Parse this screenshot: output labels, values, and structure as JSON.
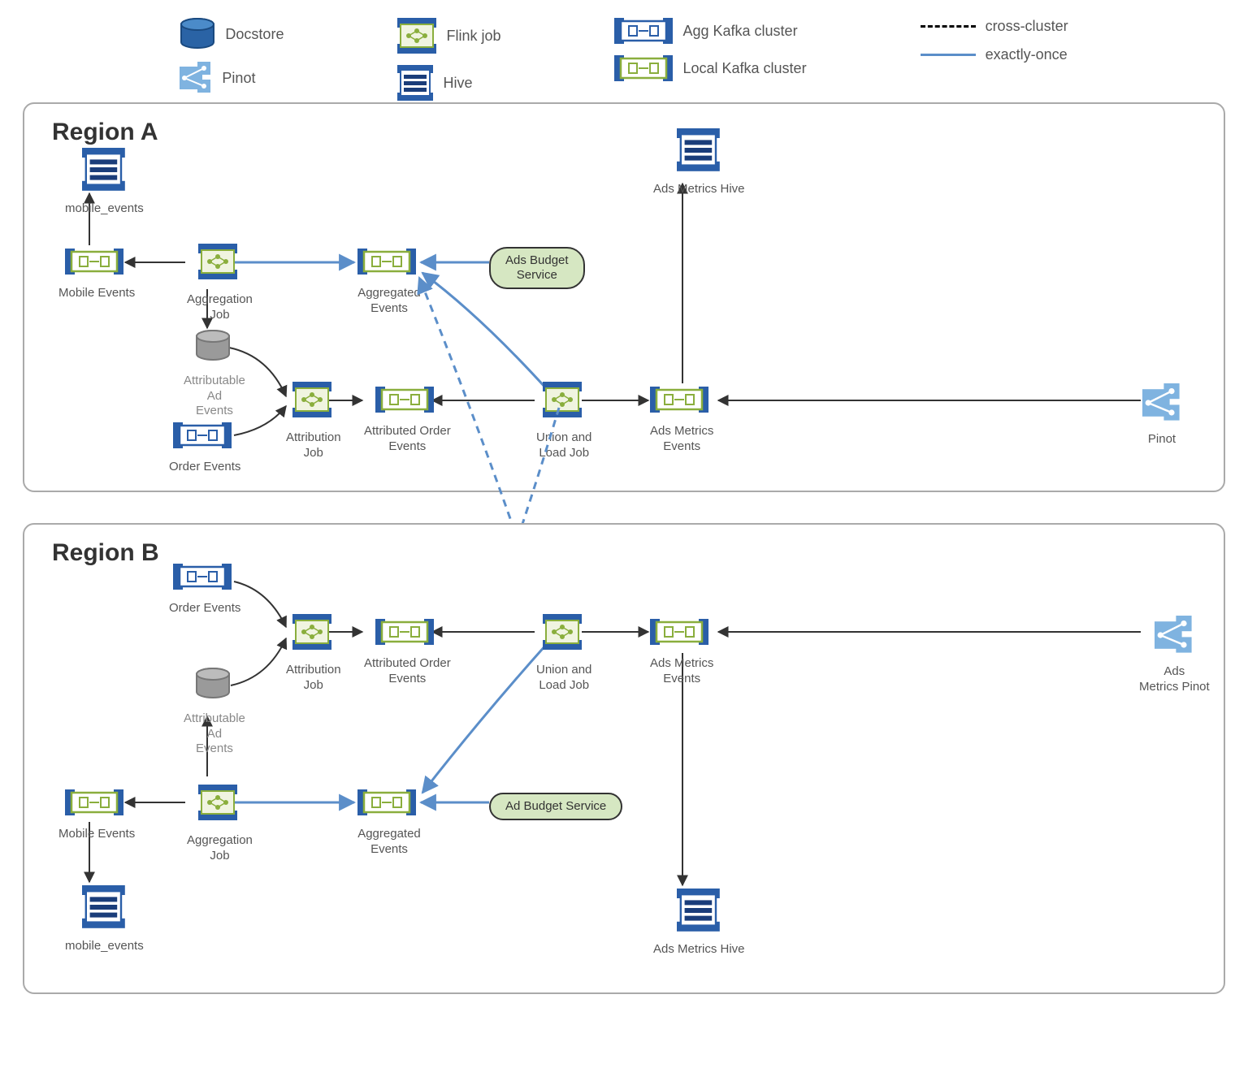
{
  "legend": {
    "docstore": "Docstore",
    "pinot": "Pinot",
    "flink": "Flink job",
    "hive": "Hive",
    "aggKafka": "Agg Kafka cluster",
    "localKafka": "Local Kafka cluster",
    "cross": "cross-cluster",
    "exactly": "exactly-once"
  },
  "regionA": {
    "title": "Region A",
    "mobileEventsHive": "mobile_events",
    "mobileEventsKafka": "Mobile Events",
    "aggregationJob": "Aggregation\nJob",
    "aggregatedEvents": "Aggregated\nEvents",
    "adsBudgetService": "Ads Budget\nService",
    "attributableAdEvents": "Attributable\nAd\nEvents",
    "attributionJob": "Attribution\nJob",
    "attributedOrderEvents": "Attributed Order\nEvents",
    "orderEvents": "Order Events",
    "unionLoadJob": "Union and\nLoad Job",
    "adsMetricsEvents": "Ads Metrics\nEvents",
    "adsMetricsHive": "Ads Metrics Hive",
    "pinot": "Pinot"
  },
  "regionB": {
    "title": "Region B",
    "orderEvents": "Order Events",
    "attributionJob": "Attribution\nJob",
    "attributedOrderEvents": "Attributed Order\nEvents",
    "attributableAdEvents": "Attributable\nAd\nEvents",
    "unionLoadJob": "Union and\nLoad Job",
    "adsMetricsEvents": "Ads Metrics\nEvents",
    "adsMetricsPinot": "Ads\nMetrics Pinot",
    "mobileEventsKafka": "Mobile Events",
    "aggregationJob": "Aggregation\nJob",
    "aggregatedEvents": "Aggregated\nEvents",
    "adBudgetService": "Ad Budget Service",
    "mobileEventsHive": "mobile_events",
    "adsMetricsHive": "Ads Metrics Hive"
  }
}
